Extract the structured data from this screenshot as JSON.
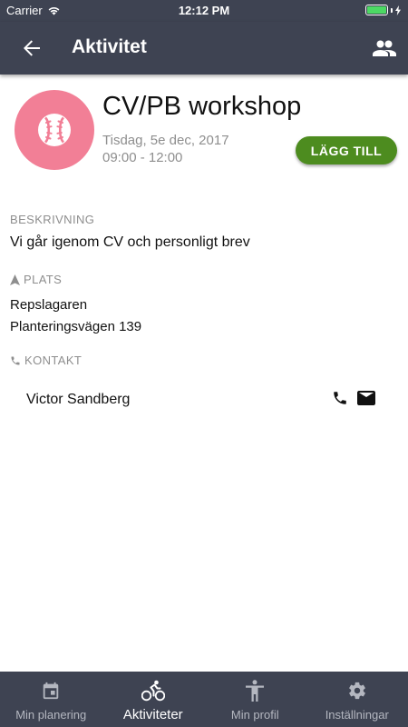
{
  "status_bar": {
    "carrier": "Carrier",
    "time": "12:12 PM",
    "battery_level": 1.0
  },
  "app_bar": {
    "title": "Aktivitet",
    "back_icon": "arrow-back-icon",
    "people_icon": "people-icon"
  },
  "activity": {
    "icon": "baseball-icon",
    "icon_bg_color": "#f27f96",
    "title": "CV/PB workshop",
    "date": "Tisdag, 5e dec, 2017",
    "time": "09:00 - 12:00",
    "add_button_label": "LÄGG TILL",
    "add_button_color": "#4d8c1f"
  },
  "description": {
    "label": "BESKRIVNING",
    "text": "Vi går igenom CV och personligt brev"
  },
  "location": {
    "label": "PLATS",
    "name": "Repslagaren",
    "address": "Planteringsvägen 139"
  },
  "contact": {
    "label": "KONTAKT",
    "name": "Victor Sandberg"
  },
  "tabs": [
    {
      "label": "Min planering",
      "icon": "calendar-icon",
      "active": false
    },
    {
      "label": "Aktiviteter",
      "icon": "bicycle-icon",
      "active": true
    },
    {
      "label": "Min profil",
      "icon": "person-icon",
      "active": false
    },
    {
      "label": "Inställningar",
      "icon": "gear-icon",
      "active": false
    }
  ],
  "colors": {
    "bar_background": "#3e4352",
    "accent": "#4d8c1f"
  }
}
